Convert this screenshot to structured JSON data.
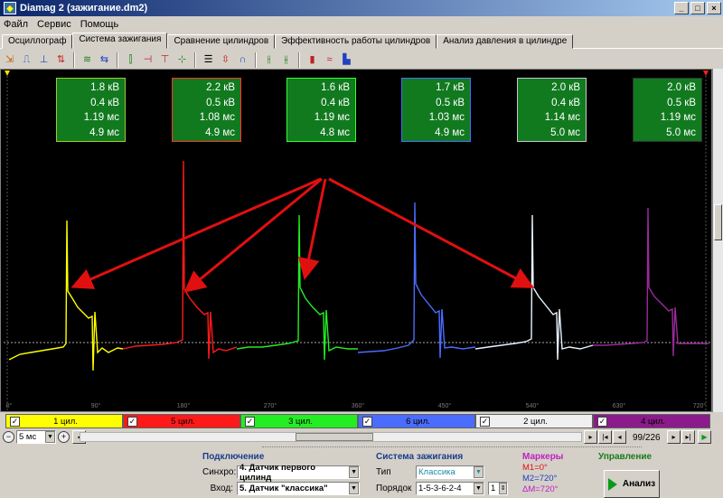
{
  "window": {
    "title": "Diamag 2 (зажигание.dm2)"
  },
  "menu": [
    "Файл",
    "Сервис",
    "Помощь"
  ],
  "tabs": [
    {
      "label": "Осциллограф",
      "active": false
    },
    {
      "label": "Система зажигания",
      "active": true
    },
    {
      "label": "Сравнение цилиндров",
      "active": false
    },
    {
      "label": "Эффективность работы цилиндров",
      "active": false
    },
    {
      "label": "Анализ давления в цилиндре",
      "active": false
    }
  ],
  "info_boxes": [
    {
      "lines": [
        "1.8 кВ",
        "0.4 кВ",
        "1.19 мс",
        "4.9 мс"
      ],
      "border": "#9acd32"
    },
    {
      "lines": [
        "2.2 кВ",
        "0.5 кВ",
        "1.08 мс",
        "4.9 мс"
      ],
      "border": "#ff3030"
    },
    {
      "lines": [
        "1.6 кВ",
        "0.4 кВ",
        "1.19 мс",
        "4.8 мс"
      ],
      "border": "#33ff33"
    },
    {
      "lines": [
        "1.7 кВ",
        "0.5 кВ",
        "1.03 мс",
        "4.9 мс"
      ],
      "border": "#4a6cff"
    },
    {
      "lines": [
        "2.0 кВ",
        "0.4 кВ",
        "1.14 мс",
        "5.0 мс"
      ],
      "border": "#c8c8c8"
    },
    {
      "lines": [
        "2.0 кВ",
        "0.5 кВ",
        "1.19 мс",
        "5.0 мс"
      ],
      "border": "#303030"
    }
  ],
  "x_ticks": [
    "0°",
    "90°",
    "180°",
    "270°",
    "360°",
    "450°",
    "540°",
    "630°",
    "720°"
  ],
  "cylinders": [
    {
      "label": "1 цил.",
      "color": "#ffff00",
      "text_color": "#000000",
      "checked": "✓"
    },
    {
      "label": "5 цил.",
      "color": "#ff1a1a",
      "text_color": "#000000",
      "checked": "✓"
    },
    {
      "label": "3 цил.",
      "color": "#22ee22",
      "text_color": "#000000",
      "checked": "✓"
    },
    {
      "label": "6 цил.",
      "color": "#4a6cff",
      "text_color": "#000000",
      "checked": "✓"
    },
    {
      "label": "2 цил.",
      "color": "#f0f0f0",
      "text_color": "#000000",
      "checked": "✓"
    },
    {
      "label": "4 цил.",
      "color": "#8b1a8b",
      "text_color": "#000000",
      "checked": "✓"
    }
  ],
  "timebase": "5 мс",
  "page": "99/226",
  "panels": {
    "connection": {
      "title": "Подключение",
      "sync_label": "Синхро:",
      "sync_value": "4.  Датчик первого цилинд",
      "input_label": "Вход:",
      "input_value": "5.  Датчик \"классика\""
    },
    "ignition": {
      "title": "Система зажигания",
      "type_label": "Тип",
      "type_value": "Классика",
      "order_label": "Порядок",
      "order_value": "1-5-3-6-2-4",
      "order_spin": "1"
    },
    "markers": {
      "title": "Маркеры",
      "m1": "M1=0°",
      "m2": "M2=720°",
      "dm": "ΔM=720°"
    },
    "control": {
      "title": "Управление",
      "analyze": "Анализ"
    }
  }
}
